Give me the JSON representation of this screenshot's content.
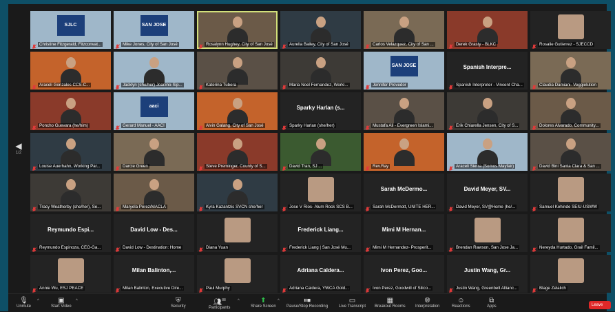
{
  "page_nav": {
    "arrow": "◀",
    "page": "1/2"
  },
  "tiles": [
    {
      "label": "Christine Fitzgerald, Fitzconvat...",
      "type": "logo",
      "logo": "SJLC"
    },
    {
      "label": "Mike Jones, City of San José",
      "type": "logo",
      "logo": "SAN JOSE"
    },
    {
      "label": "Rosalynn Hughey, City of San José",
      "type": "cam",
      "active": true
    },
    {
      "label": "Aurelia Bailey, City of San José",
      "type": "cam"
    },
    {
      "label": "Carlos Velazquez, City of San ...",
      "type": "cam"
    },
    {
      "label": "Derek Grasty - BLKC",
      "type": "cam"
    },
    {
      "label": "Rosalie Gutierrez - SJECCD",
      "type": "avatar"
    },
    {
      "label": "Araceli Gonzales CCS-C...",
      "type": "cam"
    },
    {
      "label": "Jacklyn (she/her) Joanino-Sip...",
      "type": "cam"
    },
    {
      "label": "Katerina Tubera",
      "type": "cam"
    },
    {
      "label": "Maria Noel Fernandez, Worki...",
      "type": "cam"
    },
    {
      "label": "Jennifer Provedor",
      "type": "logo",
      "logo": "SAN JOSE"
    },
    {
      "label": "Spanish Interpreter - Vincent Cha...",
      "type": "text",
      "center": "Spanish Interpre..."
    },
    {
      "label": "Claudia Damiani- Veggielution",
      "type": "cam"
    },
    {
      "label": "Poncho Guevara (he/him)",
      "type": "cam"
    },
    {
      "label": "Gerard Manuel - AACI",
      "type": "logo",
      "logo": "aaci"
    },
    {
      "label": "Alvin Galang, City of San José",
      "type": "cam"
    },
    {
      "label": "Sparky Harlan (she/her)",
      "type": "text",
      "center": "Sparky Harlan (s..."
    },
    {
      "label": "Mustafa Ali - Evergreen Islami...",
      "type": "cam"
    },
    {
      "label": "Erik Chiarella Jensen, City of S...",
      "type": "cam"
    },
    {
      "label": "Dolores Alvarado, Community...",
      "type": "cam"
    },
    {
      "label": "Louise Auerhahn, Working Par...",
      "type": "cam"
    },
    {
      "label": "Darcie Green",
      "type": "cam"
    },
    {
      "label": "Steve Preminger, County of S...",
      "type": "cam"
    },
    {
      "label": "David Tran, SJ ...",
      "type": "cam"
    },
    {
      "label": "Rev.Ray",
      "type": "cam"
    },
    {
      "label": "Araceli Sierra (Somos Mayfair)",
      "type": "cam"
    },
    {
      "label": "David Bini Santa Clara & San ...",
      "type": "cam"
    },
    {
      "label": "Tracy Weatherby (she/her), Se...",
      "type": "cam"
    },
    {
      "label": "Maryela Perez/MACLA",
      "type": "cam"
    },
    {
      "label": "Kyra Kazantzis SVCN she/her",
      "type": "cam"
    },
    {
      "label": "Jose V Rios- Alum Rock SCS B...",
      "type": "avatar"
    },
    {
      "label": "Sarah McDermott, UNITE HER...",
      "type": "text",
      "center": "Sarah McDermo..."
    },
    {
      "label": "David Meyer, SV@Home (he/...",
      "type": "text",
      "center": "David Meyer, SV..."
    },
    {
      "label": "Samuel Kehinde SEIU-USWW",
      "type": "avatar"
    },
    {
      "label": "Reymundo Espinoza, CEO-Ga...",
      "type": "text",
      "center": "Reymundo Espi..."
    },
    {
      "label": "David Low - Destination: Home",
      "type": "text",
      "center": "David Low - Des..."
    },
    {
      "label": "Diana Yuan",
      "type": "avatar"
    },
    {
      "label": "Frederick Liang | San José Mu...",
      "type": "text",
      "center": "Frederick Liang..."
    },
    {
      "label": "Mimi M Hernandez- Prosperit...",
      "type": "text",
      "center": "Mimi M Hernan..."
    },
    {
      "label": "Brendan Rawson, San Jose Ja...",
      "type": "avatar"
    },
    {
      "label": "Nereyda Hurtado, Grail Famil...",
      "type": "avatar"
    },
    {
      "label": "Annie Wu, ESJ PEACE",
      "type": "avatar"
    },
    {
      "label": "Milan Balinton, Executive Dire...",
      "type": "text",
      "center": "Milan Balinton,..."
    },
    {
      "label": "Paul Murphy",
      "type": "avatar"
    },
    {
      "label": "Adriana Caldera, YWCA Gold...",
      "type": "text",
      "center": "Adriana Caldera..."
    },
    {
      "label": "Ivon Perez, Goodwill of Silico...",
      "type": "text",
      "center": "Ivon Perez, Goo..."
    },
    {
      "label": "Justin Wang, Greenbelt Allianc...",
      "type": "text",
      "center": "Justin Wang, Gr..."
    },
    {
      "label": "Blage Zelalich",
      "type": "avatar"
    }
  ],
  "toolbar": {
    "unmute": "Unmute",
    "start_video": "Start Video",
    "security": "Security",
    "participants": "Participants",
    "participants_count": "88",
    "share_screen": "Share Screen",
    "record": "Pause/Stop Recording",
    "transcript": "Live Transcript",
    "breakout": "Breakout Rooms",
    "interpretation": "Interpretation",
    "reactions": "Reactions",
    "apps": "Apps",
    "leave": "Leave"
  },
  "colors": {
    "accent_green": "#2fbf4a",
    "leave_red": "#e02828",
    "frame": "#0e4f66",
    "active_speaker": "#d2e07a"
  }
}
